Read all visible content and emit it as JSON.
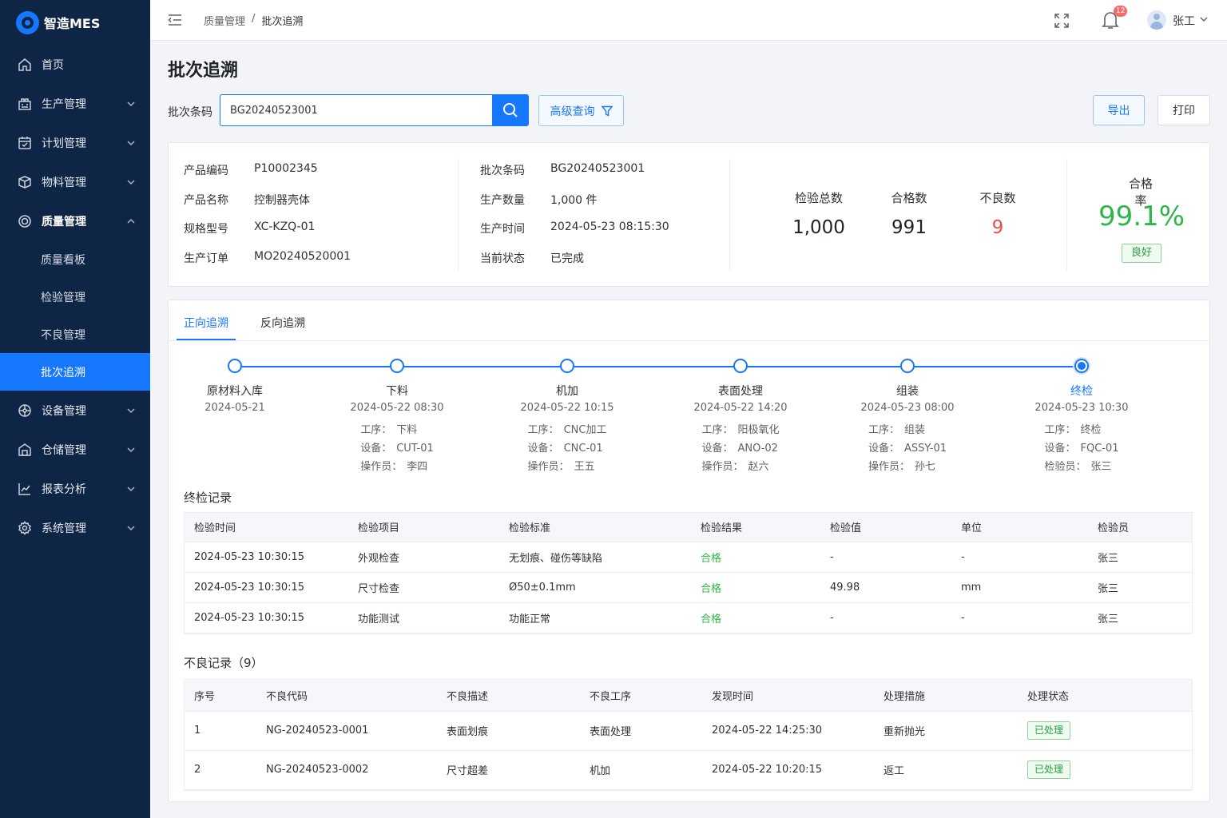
{
  "brand": {
    "name": "智造MES"
  },
  "sidebar": {
    "items": [
      {
        "label": "首页",
        "icon": "home-icon"
      },
      {
        "label": "生产管理",
        "icon": "factory-icon"
      },
      {
        "label": "计划管理",
        "icon": "plan-icon"
      },
      {
        "label": "物料管理",
        "icon": "box-icon"
      },
      {
        "label": "质量管理",
        "icon": "quality-icon"
      },
      {
        "label": "设备管理",
        "icon": "equipment-icon"
      },
      {
        "label": "仓储管理",
        "icon": "warehouse-icon"
      },
      {
        "label": "报表分析",
        "icon": "chart-icon"
      },
      {
        "label": "系统管理",
        "icon": "gear-icon"
      }
    ],
    "quality_sub": [
      "质量看板",
      "检验管理",
      "不良管理",
      "批次追溯"
    ]
  },
  "header": {
    "breadcrumb": [
      "质量管理",
      "批次追溯"
    ],
    "separator": "/",
    "notify_count": "12",
    "user": "张工"
  },
  "page": {
    "title": "批次追溯",
    "search_label": "批次条码",
    "search_value": "BG20240523001",
    "advanced_label": "高级查询",
    "export_label": "导出",
    "print_label": "打印"
  },
  "info": {
    "left": [
      {
        "k": "产品编码",
        "v": "P10002345"
      },
      {
        "k": "产品名称",
        "v": "控制器壳体"
      },
      {
        "k": "规格型号",
        "v": "XC-KZQ-01"
      },
      {
        "k": "生产订单",
        "v": "MO20240520001"
      }
    ],
    "mid": [
      {
        "k": "批次条码",
        "v": "BG20240523001"
      },
      {
        "k": "生产数量",
        "v": "1,000  件"
      },
      {
        "k": "生产时间",
        "v": "2024-05-23 08:15:30"
      },
      {
        "k": "当前状态",
        "v": "已完成"
      }
    ],
    "stats": [
      {
        "label": "检验总数",
        "value": "1,000"
      },
      {
        "label": "合格数",
        "value": "991"
      },
      {
        "label": "不良数",
        "value": "9"
      }
    ],
    "rate_label": "合格率",
    "rate_value": "99.1%",
    "rate_tag": "良好"
  },
  "trace": {
    "tabs": [
      "正向追溯",
      "反向追溯"
    ],
    "nodes": [
      {
        "name": "原材料入库",
        "date": "2024-05-21",
        "details": []
      },
      {
        "name": "下料",
        "date": "2024-05-22 08:30",
        "details": [
          [
            "工序：",
            "下料"
          ],
          [
            "设备：",
            "CUT-01"
          ],
          [
            "操作员：",
            "李四"
          ]
        ]
      },
      {
        "name": "机加",
        "date": "2024-05-22 10:15",
        "details": [
          [
            "工序：",
            "CNC加工"
          ],
          [
            "设备：",
            "CNC-01"
          ],
          [
            "操作员：",
            "王五"
          ]
        ]
      },
      {
        "name": "表面处理",
        "date": "2024-05-22 14:20",
        "details": [
          [
            "工序：",
            "阳极氧化"
          ],
          [
            "设备：",
            "ANO-02"
          ],
          [
            "操作员：",
            "赵六"
          ]
        ]
      },
      {
        "name": "组装",
        "date": "2024-05-23 08:00",
        "details": [
          [
            "工序：",
            "组装"
          ],
          [
            "设备：",
            "ASSY-01"
          ],
          [
            "操作员：",
            "孙七"
          ]
        ]
      },
      {
        "name": "终检",
        "date": "2024-05-23 10:30",
        "details": [
          [
            "工序：",
            "终检"
          ],
          [
            "设备：",
            "FQC-01"
          ],
          [
            "检验员：",
            "张三"
          ]
        ]
      }
    ]
  },
  "inspect": {
    "title": "终检记录",
    "columns": [
      "检验时间",
      "检验项目",
      "检验标准",
      "检验结果",
      "检验值",
      "单位",
      "检验员"
    ],
    "rows": [
      [
        "2024-05-23 10:30:15",
        "外观检查",
        "无划痕、碰伤等缺陷",
        "合格",
        "-",
        "-",
        "张三"
      ],
      [
        "2024-05-23 10:30:15",
        "尺寸检查",
        "Ø50±0.1mm",
        "合格",
        "49.98",
        "mm",
        "张三"
      ],
      [
        "2024-05-23 10:30:15",
        "功能测试",
        "功能正常",
        "合格",
        "-",
        "-",
        "张三"
      ]
    ]
  },
  "defects": {
    "title": "不良记录（9）",
    "columns": [
      "序号",
      "不良代码",
      "不良描述",
      "不良工序",
      "发现时间",
      "处理措施",
      "处理状态"
    ],
    "rows": [
      [
        "1",
        "NG-20240523-0001",
        "表面划痕",
        "表面处理",
        "2024-05-22 14:25:30",
        "重新抛光",
        "已处理"
      ],
      [
        "2",
        "NG-20240523-0002",
        "尺寸超差",
        "机加",
        "2024-05-22 10:20:15",
        "返工",
        "已处理"
      ]
    ]
  },
  "colors": {
    "sidebar": "#0f2545",
    "primary": "#1677ff",
    "success": "#2fb64a",
    "danger": "#f04c4c"
  }
}
